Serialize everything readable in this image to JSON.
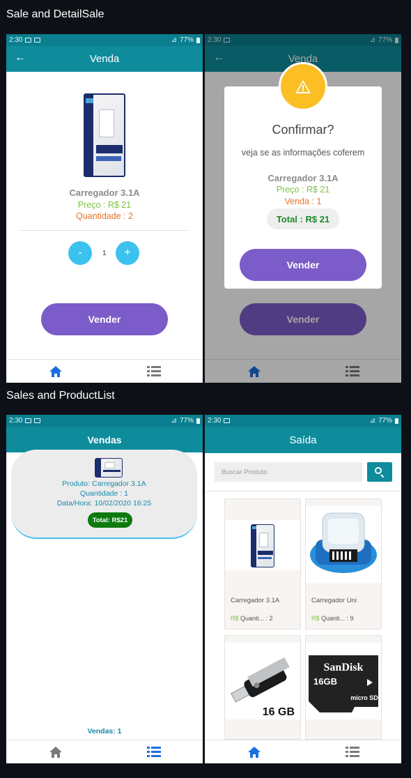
{
  "sections": {
    "first": "Sale and DetailSale",
    "second": "Sales and ProductList"
  },
  "status": {
    "time": "2:30",
    "battery": "77%"
  },
  "detail": {
    "title": "Venda",
    "product_name": "Carregador 3.1A",
    "price": "Preço : R$ 21",
    "quantity": "Quantidade : 2",
    "minus": "-",
    "plus": "+",
    "stepper_value": "1",
    "sell_button": "Vender"
  },
  "confirm": {
    "title": "Venda",
    "dialog_title": "Confirmar?",
    "message": "veja se as informações coferem",
    "product_name": "Carregador 3.1A",
    "price": "Preço : R$ 21",
    "sale": "Venda : 1",
    "total": "Total : R$ 21",
    "confirm_button": "Vender",
    "background_button": "Vender"
  },
  "sales": {
    "title": "Vendas",
    "items": [
      {
        "product": "Produto: Carregador 3.1A",
        "quantity": "Quantidade : 1",
        "datetime": "Data/Hora: 10/02/2020 16:25",
        "total": "Total: R$21"
      }
    ],
    "count": "Vendas: 1"
  },
  "products": {
    "title": "Saída",
    "search_placeholder": "Buscar Produto",
    "items": [
      {
        "name": "Carregador 3.1A",
        "currency": "R$",
        "qty_label": "Quanti... : 2"
      },
      {
        "name": "Carregador Uni",
        "currency": "R$",
        "qty_label": "Quanti... : 9"
      },
      {
        "image_text": "16 GB"
      },
      {
        "image_brand": "SanDisk",
        "image_size": "16GB",
        "image_format": "micro SD"
      }
    ]
  },
  "colors": {
    "primary": "#0e8c9c",
    "accent_purple": "#7b5cc8",
    "accent_cyan": "#3cc2ef",
    "warning": "#fbbf24",
    "price_green": "#7cc242",
    "qty_orange": "#e8742a",
    "total_green": "#0d7a10",
    "nav_active": "#1a6fe0"
  },
  "icons": [
    "back-arrow-icon",
    "home-icon",
    "list-icon",
    "warning-icon",
    "search-icon",
    "signal-icon",
    "wifi-icon",
    "battery-icon"
  ]
}
